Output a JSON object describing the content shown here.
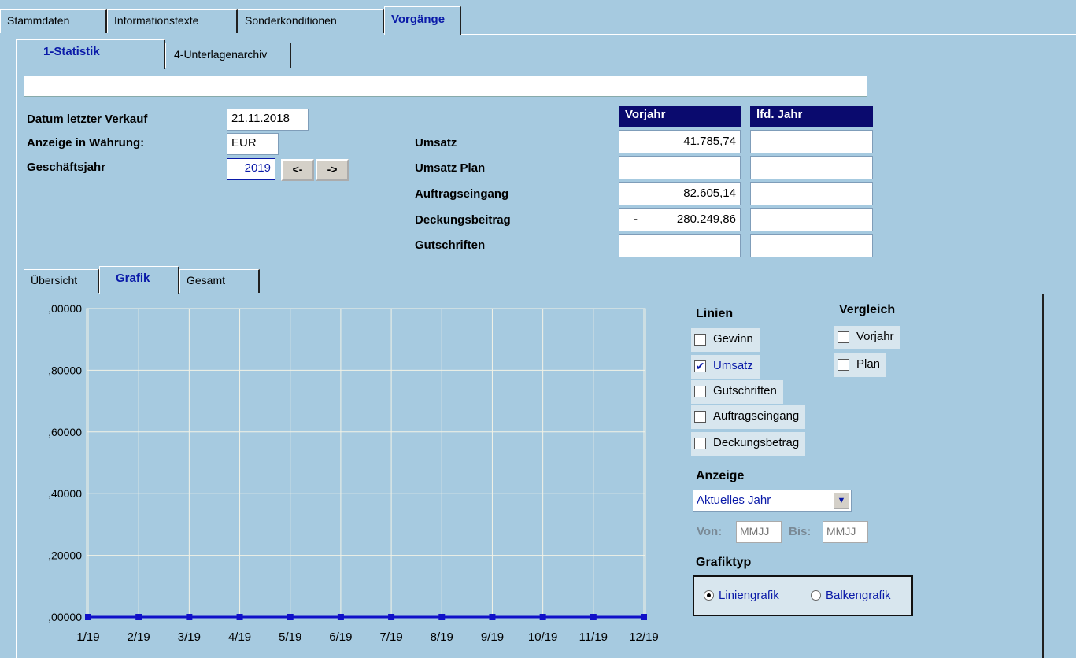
{
  "main_tabs": [
    {
      "label": "Stammdaten",
      "active": false
    },
    {
      "label": "Informationstexte",
      "active": false
    },
    {
      "label": "Sonderkonditionen",
      "active": false
    },
    {
      "label": "Vorgänge",
      "active": true
    }
  ],
  "sub_tabs": [
    {
      "label": "1-Statistik",
      "active": true
    },
    {
      "label": "4-Unterlagenarchiv",
      "active": false
    }
  ],
  "info": {
    "datum_label": "Datum letzter Verkauf",
    "datum_value": "21.11.2018",
    "waehrung_label": "Anzeige in Währung:",
    "waehrung_value": "EUR",
    "geschaeftsjahr_label": "Geschäftsjahr",
    "geschaeftsjahr_value": "2019",
    "prev_label": "<-",
    "next_label": "->"
  },
  "table": {
    "col_vorjahr": "Vorjahr",
    "col_lfd": "lfd. Jahr",
    "rows": [
      {
        "label": "Umsatz",
        "vorjahr": "41.785,74",
        "lfd": ""
      },
      {
        "label": "Umsatz Plan",
        "vorjahr": "",
        "lfd": ""
      },
      {
        "label": "Auftragseingang",
        "vorjahr": "82.605,14",
        "lfd": ""
      },
      {
        "label": "Deckungsbeitrag",
        "vorjahr_sign": "-",
        "vorjahr": "280.249,86",
        "lfd": ""
      },
      {
        "label": "Gutschriften",
        "vorjahr": "",
        "lfd": ""
      }
    ]
  },
  "lower_tabs": [
    {
      "label": "Übersicht",
      "active": false
    },
    {
      "label": "Grafik",
      "active": true
    },
    {
      "label": "Gesamt",
      "active": false
    }
  ],
  "options": {
    "linien_title": "Linien",
    "linien": [
      {
        "label": "Gewinn",
        "checked": false
      },
      {
        "label": "Umsatz",
        "checked": true
      },
      {
        "label": "Gutschriften",
        "checked": false
      },
      {
        "label": "Auftragseingang",
        "checked": false
      },
      {
        "label": "Deckungsbetrag",
        "checked": false
      }
    ],
    "vergleich_title": "Vergleich",
    "vergleich": [
      {
        "label": "Vorjahr",
        "checked": false
      },
      {
        "label": "Plan",
        "checked": false
      }
    ],
    "anzeige_title": "Anzeige",
    "anzeige_value": "Aktuelles Jahr",
    "von_label": "Von:",
    "von_placeholder": "MMJJ",
    "bis_label": "Bis:",
    "bis_placeholder": "MMJJ",
    "grafiktyp_title": "Grafiktyp",
    "radio_linie": "Liniengrafik",
    "radio_balken": "Balkengrafik",
    "selected_type": "Liniengrafik"
  },
  "colors": {
    "background": "#a6cae0",
    "accent": "#0a1aa8",
    "header_bg": "#0a0a6e",
    "line": "#1010c8"
  },
  "chart_data": {
    "type": "line",
    "categories": [
      "1/19",
      "2/19",
      "3/19",
      "4/19",
      "5/19",
      "6/19",
      "7/19",
      "8/19",
      "9/19",
      "10/19",
      "11/19",
      "12/19"
    ],
    "series": [
      {
        "values": [
          0,
          0,
          0,
          0,
          0,
          0,
          0,
          0,
          0,
          0,
          0,
          0
        ]
      }
    ],
    "y_tick_labels": [
      ",00000",
      ",20000",
      ",40000",
      ",60000",
      ",80000",
      ",00000"
    ],
    "ylim": [
      0,
      1
    ],
    "grid": true
  }
}
